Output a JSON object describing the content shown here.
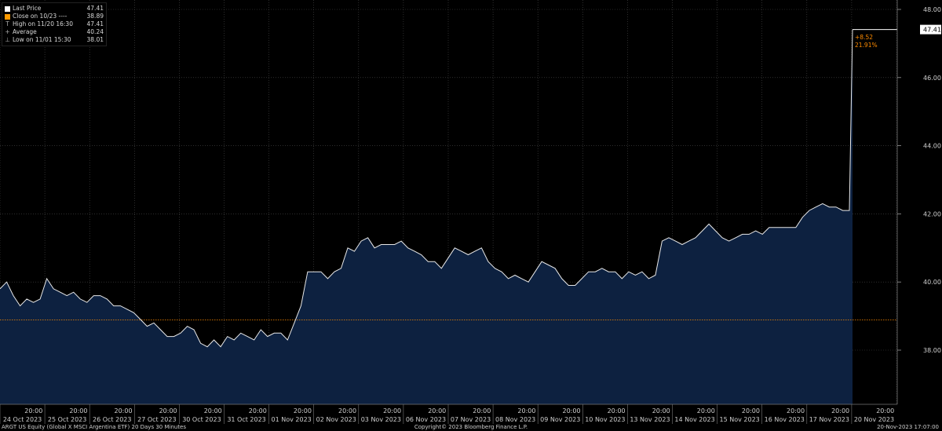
{
  "chart_data": {
    "type": "area",
    "title": "",
    "xlabel": "",
    "ylabel": "",
    "ylim": [
      36.7,
      48.3
    ],
    "yticks": [
      38,
      40,
      42,
      44,
      46,
      48
    ],
    "ytick_labels": [
      "38.00",
      "40.00",
      "42.00",
      "44.00",
      "46.00",
      "48.00"
    ],
    "x_time_labels": [
      "20:00",
      "20:00",
      "20:00",
      "20:00",
      "20:00",
      "20:00",
      "20:00",
      "20:00",
      "20:00",
      "20:00",
      "20:00",
      "20:00",
      "20:00",
      "20:00",
      "20:00",
      "20:00",
      "20:00",
      "20:00",
      "20:00",
      "20:00"
    ],
    "x_date_labels": [
      "24 Oct 2023",
      "25 Oct 2023",
      "26 Oct 2023",
      "27 Oct 2023",
      "30 Oct 2023",
      "31 Oct 2023",
      "01 Nov 2023",
      "02 Nov 2023",
      "03 Nov 2023",
      "06 Nov 2023",
      "07 Nov 2023",
      "08 Nov 2023",
      "09 Nov 2023",
      "10 Nov 2023",
      "13 Nov 2023",
      "14 Nov 2023",
      "15 Nov 2023",
      "16 Nov 2023",
      "17 Nov 2023",
      "20 Nov 2023"
    ],
    "series": [
      {
        "name": "Last Price",
        "values": [
          39.8,
          40.0,
          39.6,
          39.3,
          39.5,
          39.4,
          39.5,
          40.1,
          39.8,
          39.7,
          39.6,
          39.7,
          39.5,
          39.4,
          39.6,
          39.6,
          39.5,
          39.3,
          39.3,
          39.2,
          39.1,
          38.9,
          38.7,
          38.8,
          38.6,
          38.4,
          38.4,
          38.5,
          38.7,
          38.6,
          38.2,
          38.1,
          38.3,
          38.1,
          38.4,
          38.3,
          38.5,
          38.4,
          38.3,
          38.6,
          38.4,
          38.5,
          38.5,
          38.3,
          38.8,
          39.3,
          40.3,
          40.3,
          40.3,
          40.1,
          40.3,
          40.4,
          41.0,
          40.9,
          41.2,
          41.3,
          41.0,
          41.1,
          41.1,
          41.1,
          41.2,
          41.0,
          40.9,
          40.8,
          40.6,
          40.6,
          40.4,
          40.7,
          41.0,
          40.9,
          40.8,
          40.9,
          41.0,
          40.6,
          40.4,
          40.3,
          40.1,
          40.2,
          40.1,
          40.0,
          40.3,
          40.6,
          40.5,
          40.4,
          40.1,
          39.9,
          39.9,
          40.1,
          40.3,
          40.3,
          40.4,
          40.3,
          40.3,
          40.1,
          40.3,
          40.2,
          40.3,
          40.1,
          40.2,
          41.2,
          41.3,
          41.2,
          41.1,
          41.2,
          41.3,
          41.5,
          41.7,
          41.5,
          41.3,
          41.2,
          41.3,
          41.4,
          41.4,
          41.5,
          41.4,
          41.6,
          41.6,
          41.6,
          41.6,
          41.6,
          41.9,
          42.1,
          42.2,
          42.3,
          42.2,
          42.2,
          42.1,
          42.1,
          47.41
        ]
      }
    ],
    "reference_line": {
      "name": "Close on 10/23",
      "value": 38.89,
      "color": "#ff8c00"
    },
    "last_price_tag": "47.41",
    "annotation": {
      "change": "+8.52",
      "percent": "21.91%",
      "color": "#ff8c00"
    },
    "grid": true,
    "area_fill": "#0d2140",
    "line_color": "#e8e8e8"
  },
  "legend": {
    "items": [
      {
        "label": "Last Price",
        "value": "47.41",
        "icon": "white-square",
        "color": "#ffffff"
      },
      {
        "label": "Close on 10/23 ----",
        "value": "38.89",
        "icon": "orange-square",
        "color": "#ff9a00"
      },
      {
        "label": "High on 11/20 16:30",
        "value": "47.41",
        "icon": "high-marker-icon",
        "glyph": "T"
      },
      {
        "label": "Average",
        "value": "40.24",
        "icon": "average-marker-icon",
        "glyph": "+"
      },
      {
        "label": "Low on 11/01 15:30",
        "value": "38.01",
        "icon": "low-marker-icon",
        "glyph": "⊥"
      }
    ]
  },
  "footer": {
    "left": "ARGT US Equity (Global X MSCI Argentina ETF) 20 Days 30 Minutes",
    "center": "Copyright© 2023 Bloomberg Finance L.P.",
    "right": "20-Nov-2023 17:07:00"
  }
}
